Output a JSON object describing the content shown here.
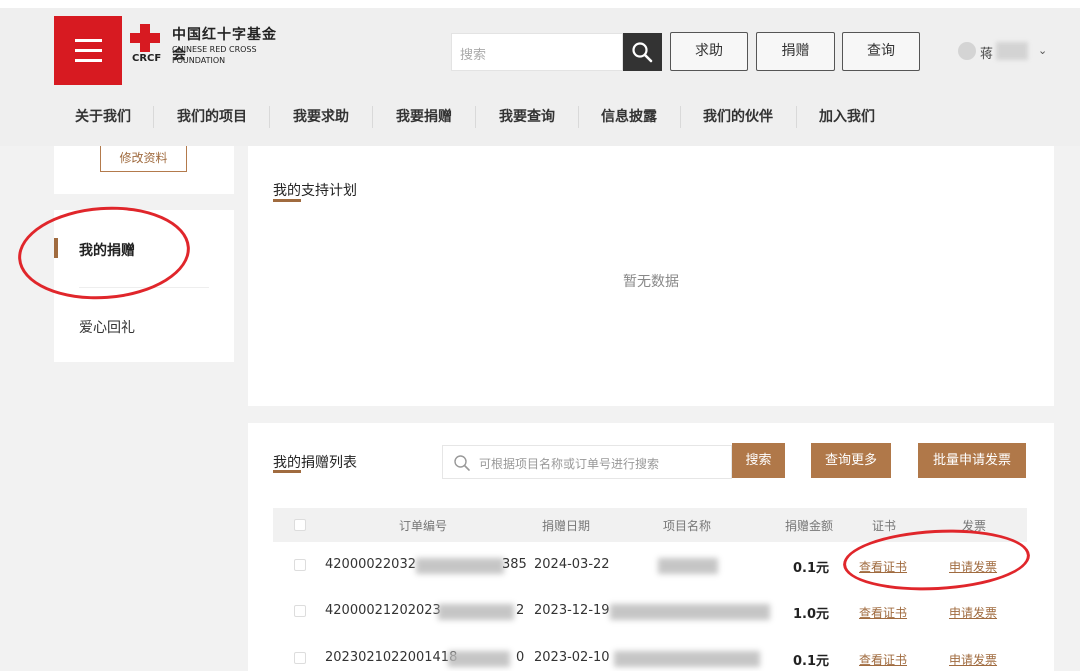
{
  "header": {
    "logo": {
      "cn": "中国红十字基金会",
      "en_line1": "CHINESE RED CROSS",
      "en_line2": "FOUNDATION",
      "abbr": "CRCF"
    },
    "search": {
      "placeholder": "搜索"
    },
    "buttons": [
      "求助",
      "捐赠",
      "查询"
    ],
    "user": {
      "name": "蒋"
    }
  },
  "nav": [
    "关于我们",
    "我们的项目",
    "我要求助",
    "我要捐赠",
    "我要查询",
    "信息披露",
    "我们的伙伴",
    "加入我们"
  ],
  "sidebar": {
    "edit_profile": "修改资料",
    "items": [
      "我的捐赠",
      "爱心回礼"
    ]
  },
  "support_plan": {
    "title": "我的支持计划",
    "empty_text": "暂无数据"
  },
  "donation_list": {
    "title": "我的捐赠列表",
    "search_placeholder": "可根据项目名称或订单号进行搜索",
    "search_button": "搜索",
    "more_button": "查询更多",
    "invoice_batch_button": "批量申请发票",
    "columns": [
      "订单编号",
      "捐赠日期",
      "项目名称",
      "捐赠金额",
      "证书",
      "发票"
    ],
    "rows": [
      {
        "order_start": "42000022032",
        "order_end": "385",
        "date": "2024-03-22",
        "project": "",
        "amount": "0.1元",
        "cert": "查看证书",
        "invoice": "申请发票"
      },
      {
        "order_start": "42000021202023",
        "order_end": "2",
        "date": "2023-12-19",
        "project": "",
        "amount": "1.0元",
        "cert": "查看证书",
        "invoice": "申请发票"
      },
      {
        "order_start": "2023021022001418",
        "order_end": "0",
        "date": "2023-02-10",
        "project": "",
        "amount": "0.1元",
        "cert": "查看证书",
        "invoice": "申请发票"
      }
    ]
  },
  "colors": {
    "brand_red": "#d71a21",
    "accent_brown": "#b07849",
    "annotation_red": "#e0262b"
  }
}
